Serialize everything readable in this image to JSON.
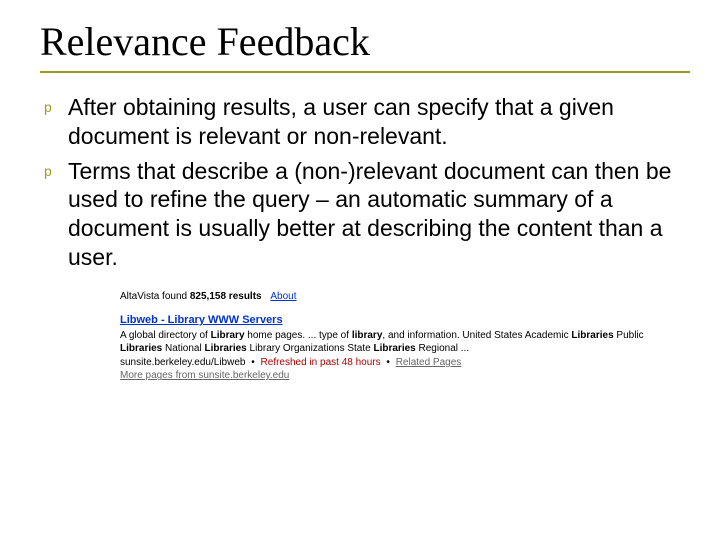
{
  "title": "Relevance Feedback",
  "bullets": [
    "After obtaining results, a user can specify that a given document is relevant or non-relevant.",
    "Terms that describe a (non-)relevant document can then be used to refine the query – an automatic summary of a document is usually better at describing the content than a user."
  ],
  "search": {
    "header_prefix": "AltaVista found ",
    "result_count": "825,158",
    "header_suffix": " results",
    "about": "About",
    "result": {
      "title": "Libweb - Library WWW Servers",
      "desc_parts": [
        "A global directory of ",
        "Library",
        " home pages. ... type of ",
        "library",
        ", and information. United States Academic ",
        "Libraries",
        " Public ",
        "Libraries",
        " National ",
        "Libraries",
        " Library Organizations State ",
        "Libraries",
        " Regional ..."
      ],
      "url": "sunsite.berkeley.edu/Libweb",
      "refreshed": "Refreshed in past 48 hours",
      "related": "Related Pages",
      "more_pages": "More pages from sunsite.berkeley.edu"
    }
  }
}
